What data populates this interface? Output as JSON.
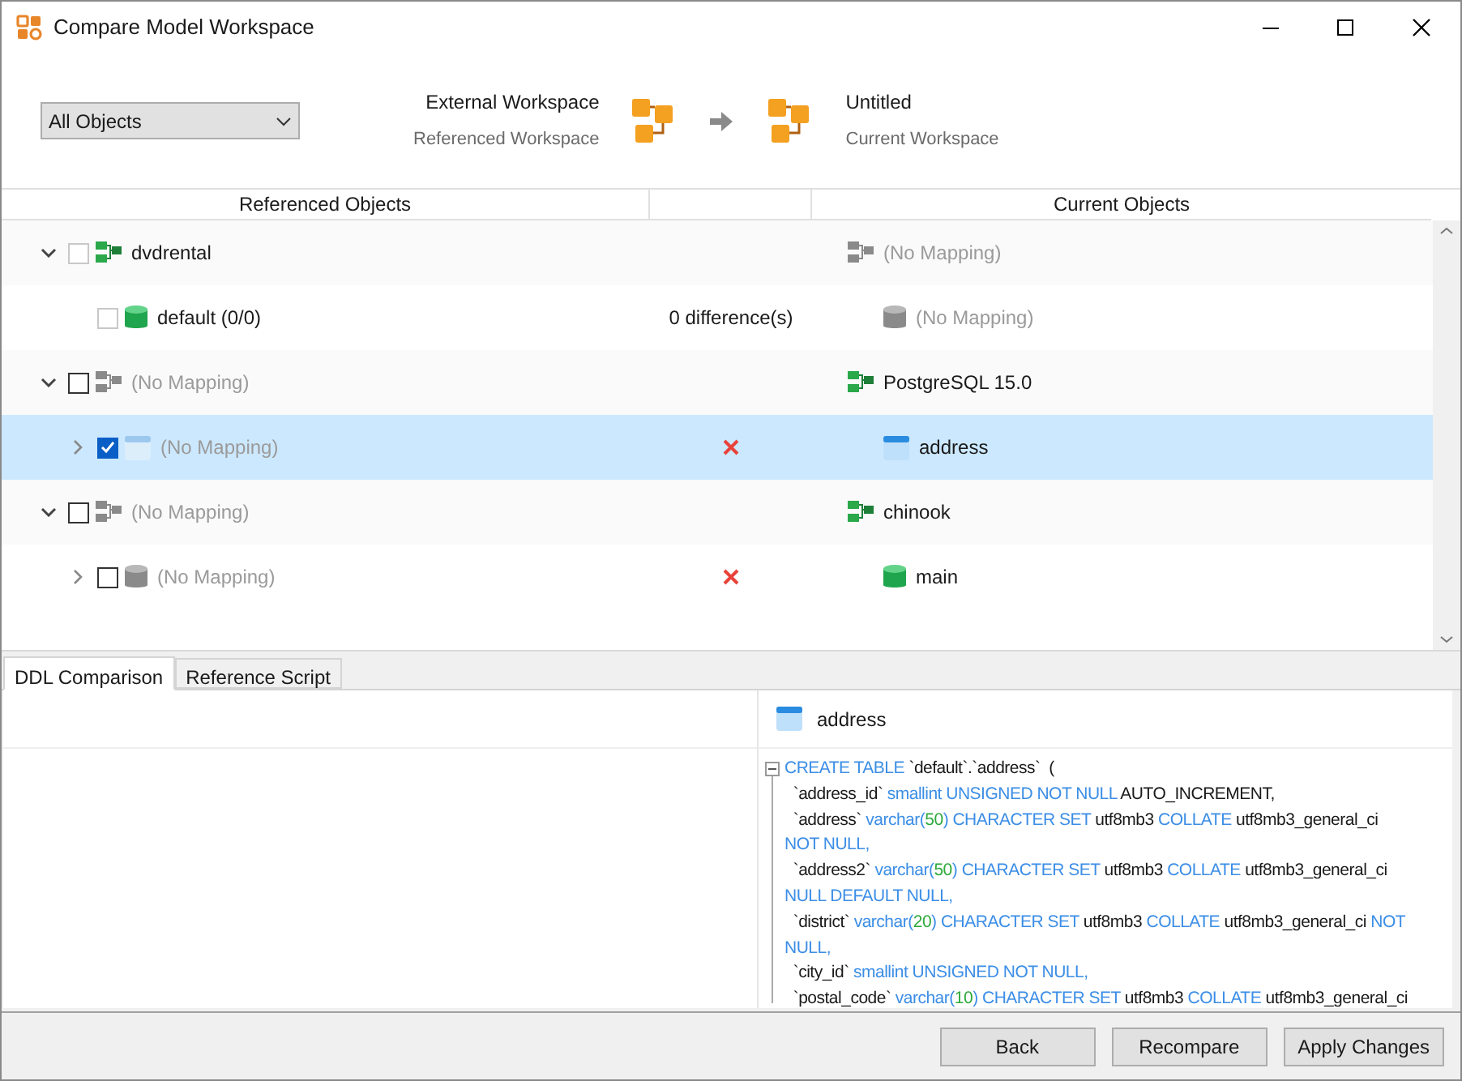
{
  "window": {
    "title": "Compare Model Workspace"
  },
  "filter": {
    "value": "All Objects"
  },
  "source": {
    "name": "External Workspace",
    "role": "Referenced Workspace"
  },
  "target": {
    "name": "Untitled",
    "role": "Current Workspace"
  },
  "columns": [
    "Referenced Objects",
    "",
    "Current Objects"
  ],
  "tree": [
    {
      "expanded": true,
      "checked": false,
      "disabled": true,
      "selected": false,
      "left": {
        "text": "dvdrental",
        "kind": "schema",
        "mapped": true
      },
      "right": {
        "text": "(No Mapping)",
        "kind": "schema",
        "mapped": false
      },
      "children": [
        {
          "checked": false,
          "disabled": true,
          "selected": false,
          "left": {
            "text": "default (0/0)",
            "kind": "database",
            "mapped": true
          },
          "difference": "0 difference(s)",
          "right": {
            "text": "(No Mapping)",
            "kind": "database",
            "mapped": false
          }
        }
      ]
    },
    {
      "expanded": true,
      "checked": false,
      "disabled": false,
      "selected": false,
      "left": {
        "text": "(No Mapping)",
        "kind": "schema",
        "mapped": false
      },
      "right": {
        "text": "PostgreSQL 15.0",
        "kind": "schema",
        "mapped": true
      },
      "children": [
        {
          "expanded": false,
          "checked": true,
          "disabled": false,
          "selected": true,
          "left": {
            "text": "(No Mapping)",
            "kind": "table",
            "mapped": false
          },
          "error": true,
          "right": {
            "text": "address",
            "kind": "table",
            "mapped": true
          }
        }
      ]
    },
    {
      "expanded": true,
      "checked": false,
      "disabled": false,
      "selected": false,
      "left": {
        "text": "(No Mapping)",
        "kind": "schema",
        "mapped": false
      },
      "right": {
        "text": "chinook",
        "kind": "schema",
        "mapped": true
      },
      "children": [
        {
          "expanded": false,
          "checked": false,
          "disabled": false,
          "selected": false,
          "left": {
            "text": "(No Mapping)",
            "kind": "database",
            "mapped": false
          },
          "error": true,
          "right": {
            "text": "main",
            "kind": "database",
            "mapped": true
          }
        }
      ]
    }
  ],
  "tabs": [
    {
      "label": "DDL Comparison",
      "selected": true
    },
    {
      "label": "Reference Script",
      "selected": false
    }
  ],
  "ddl": {
    "object": "address",
    "lines": [
      [
        {
          "kind": "keyword",
          "text": "CREATE TABLE "
        },
        {
          "kind": "plain",
          "text": "`default`.`address`  ("
        }
      ],
      [
        {
          "kind": "plain",
          "text": "  `address_id` "
        },
        {
          "kind": "keyword",
          "text": "smallint UNSIGNED NOT NULL "
        },
        {
          "kind": "plain",
          "text": "AUTO_INCREMENT,"
        }
      ],
      [
        {
          "kind": "plain",
          "text": "  `address` "
        },
        {
          "kind": "keyword",
          "text": "varchar("
        },
        {
          "kind": "number",
          "text": "50"
        },
        {
          "kind": "keyword",
          "text": ") CHARACTER SET "
        },
        {
          "kind": "plain",
          "text": "utf8mb3 "
        },
        {
          "kind": "keyword",
          "text": "COLLATE "
        },
        {
          "kind": "plain",
          "text": "utf8mb3_general_ci"
        }
      ],
      [
        {
          "kind": "keyword",
          "text": "NOT NULL,"
        }
      ],
      [
        {
          "kind": "plain",
          "text": "  `address2` "
        },
        {
          "kind": "keyword",
          "text": "varchar("
        },
        {
          "kind": "number",
          "text": "50"
        },
        {
          "kind": "keyword",
          "text": ") CHARACTER SET "
        },
        {
          "kind": "plain",
          "text": "utf8mb3 "
        },
        {
          "kind": "keyword",
          "text": "COLLATE "
        },
        {
          "kind": "plain",
          "text": "utf8mb3_general_ci"
        }
      ],
      [
        {
          "kind": "keyword",
          "text": "NULL DEFAULT NULL,"
        }
      ],
      [
        {
          "kind": "plain",
          "text": "  `district` "
        },
        {
          "kind": "keyword",
          "text": "varchar("
        },
        {
          "kind": "number",
          "text": "20"
        },
        {
          "kind": "keyword",
          "text": ") CHARACTER SET "
        },
        {
          "kind": "plain",
          "text": "utf8mb3 "
        },
        {
          "kind": "keyword",
          "text": "COLLATE "
        },
        {
          "kind": "plain",
          "text": "utf8mb3_general_ci "
        },
        {
          "kind": "keyword",
          "text": "NOT"
        }
      ],
      [
        {
          "kind": "keyword",
          "text": "NULL,"
        }
      ],
      [
        {
          "kind": "plain",
          "text": "  `city_id` "
        },
        {
          "kind": "keyword",
          "text": "smallint UNSIGNED NOT NULL,"
        }
      ],
      [
        {
          "kind": "plain",
          "text": "  `postal_code` "
        },
        {
          "kind": "keyword",
          "text": "varchar("
        },
        {
          "kind": "number",
          "text": "10"
        },
        {
          "kind": "keyword",
          "text": ") CHARACTER SET "
        },
        {
          "kind": "plain",
          "text": "utf8mb3 "
        },
        {
          "kind": "keyword",
          "text": "COLLATE "
        },
        {
          "kind": "plain",
          "text": "utf8mb3_general_ci"
        }
      ]
    ]
  },
  "buttons": [
    "Back",
    "Recompare",
    "Apply Changes"
  ]
}
